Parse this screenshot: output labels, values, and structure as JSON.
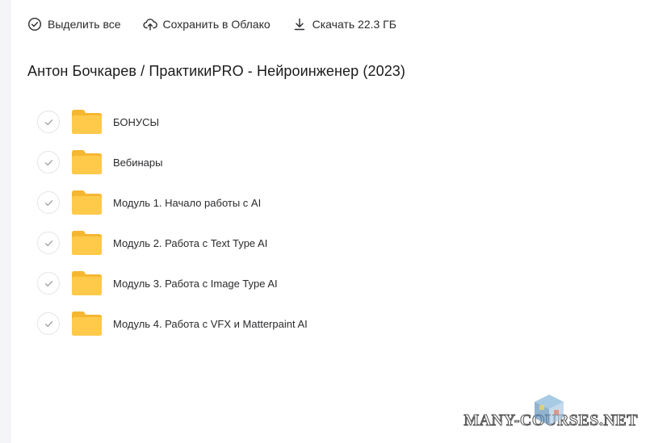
{
  "toolbar": {
    "select_all": {
      "label": "Выделить все",
      "icon": "check-circle-icon"
    },
    "save_cloud": {
      "label": "Сохранить в Облако",
      "icon": "cloud-upload-icon"
    },
    "download": {
      "label": "Скачать 22.3 ГБ",
      "icon": "download-icon"
    }
  },
  "title": "Антон Бочкарев / ПрактикиPRO - Нейроинженер (2023)",
  "items": [
    {
      "name": "БОНУСЫ"
    },
    {
      "name": "Вебинары"
    },
    {
      "name": "Модуль 1. Начало работы с AI"
    },
    {
      "name": "Модуль 2. Работа с Text Type AI"
    },
    {
      "name": "Модуль 3. Работа с Image Type AI"
    },
    {
      "name": "Модуль 4. Работа с VFX и Matterpaint AI"
    }
  ],
  "watermark": "MANY-COURSES.NET",
  "colors": {
    "folder": "#ffc94a",
    "folder_back": "#f5b731",
    "check": "#9a9ca3",
    "circle_border": "#e3e4e8"
  }
}
